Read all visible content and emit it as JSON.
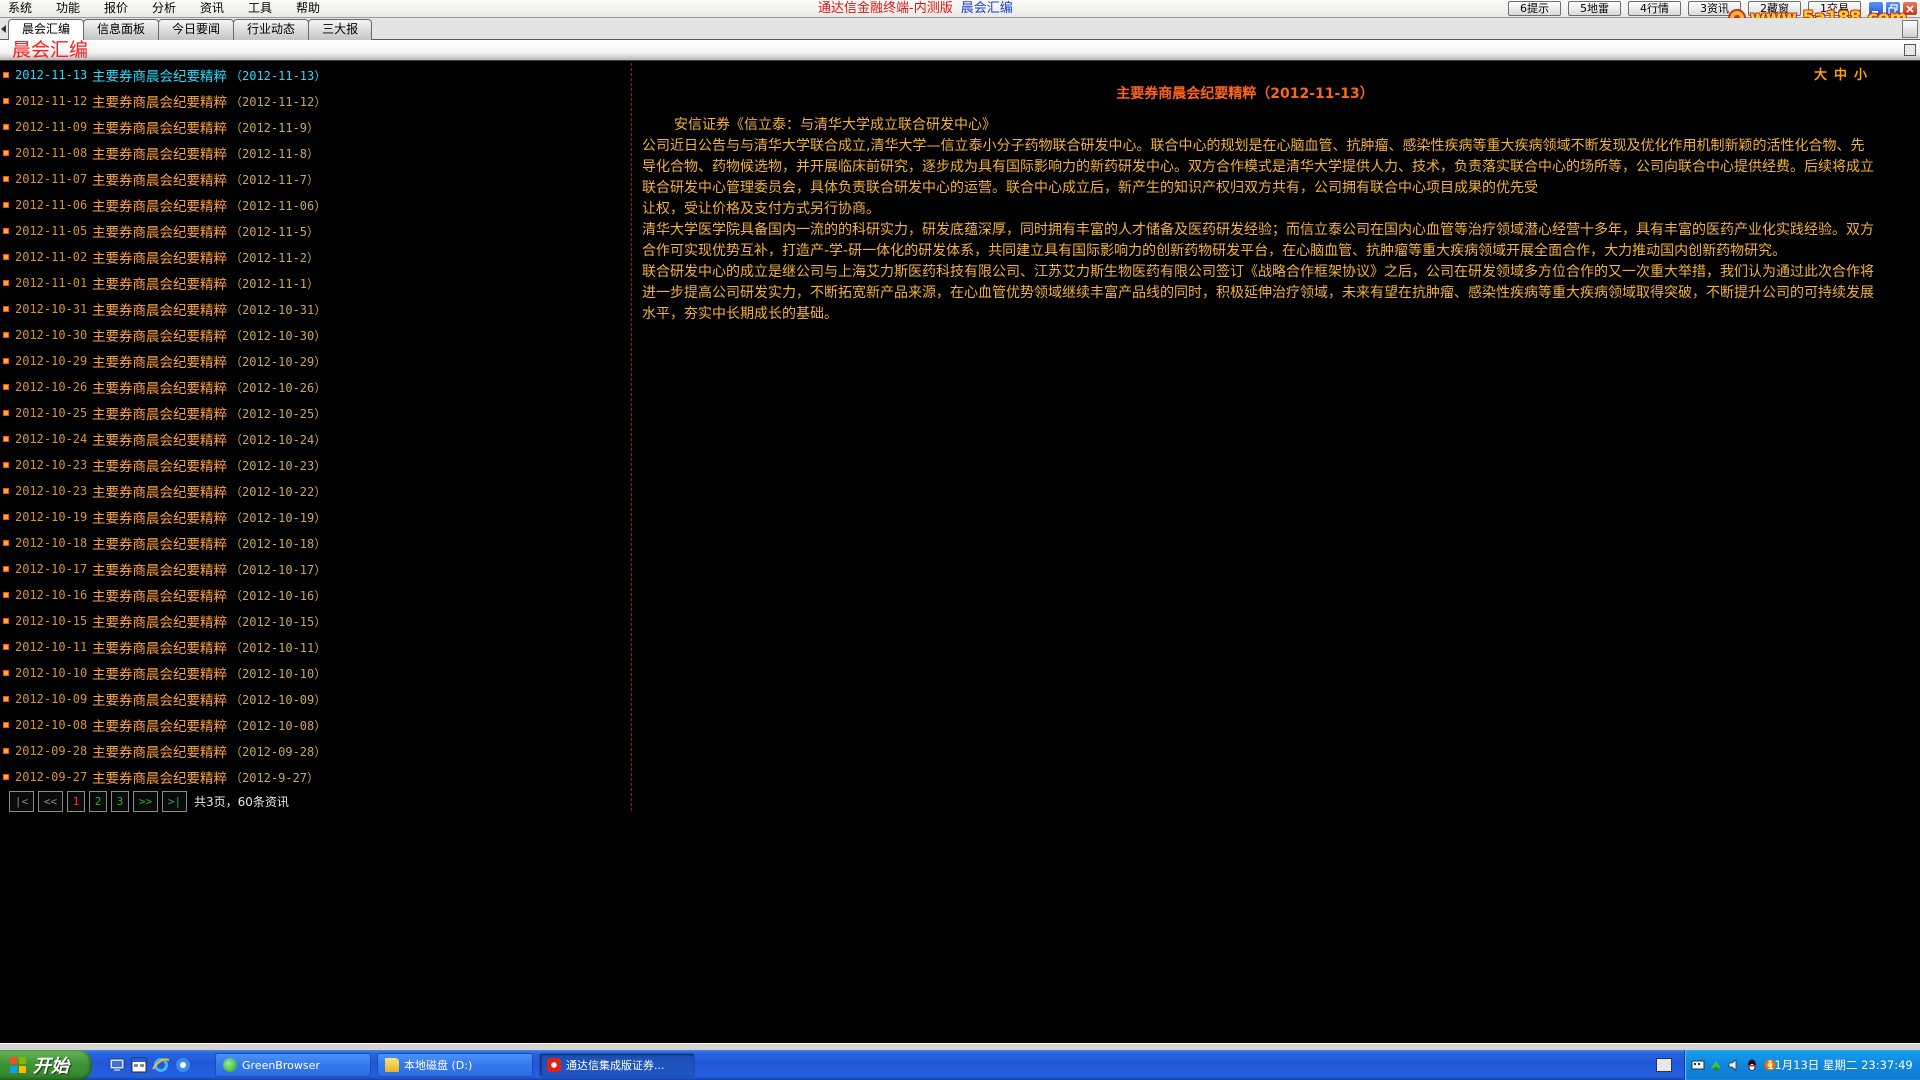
{
  "window": {
    "menu": [
      "系统",
      "功能",
      "报价",
      "分析",
      "资讯",
      "工具",
      "帮助"
    ],
    "title_app": "通达信金融终端-内测版",
    "title_page": "晨会汇编",
    "quick_buttons": [
      "6提示",
      "5地雷",
      "4行情",
      "3资讯",
      "2藏窗",
      "1交易"
    ],
    "window_controls": [
      "minimize-icon",
      "restore-icon",
      "close-icon"
    ],
    "watermark": "www.5a188.com"
  },
  "tabs": [
    {
      "label": "晨会汇编",
      "active": true
    },
    {
      "label": "信息面板"
    },
    {
      "label": "今日要闻"
    },
    {
      "label": "行业动态"
    },
    {
      "label": "三大报"
    }
  ],
  "header": {
    "title": "晨会汇编"
  },
  "list": {
    "items": [
      {
        "date": "2012-11-13",
        "title": "主要券商晨会纪要精粹",
        "suffix": "（2012-11-13）",
        "selected": true
      },
      {
        "date": "2012-11-12",
        "title": "主要券商晨会纪要精粹",
        "suffix": "（2012-11-12）"
      },
      {
        "date": "2012-11-09",
        "title": "主要券商晨会纪要精粹",
        "suffix": "（2012-11-9）"
      },
      {
        "date": "2012-11-08",
        "title": "主要券商晨会纪要精粹",
        "suffix": "（2012-11-8）"
      },
      {
        "date": "2012-11-07",
        "title": "主要券商晨会纪要精粹",
        "suffix": "（2012-11-7）"
      },
      {
        "date": "2012-11-06",
        "title": "主要券商晨会纪要精粹",
        "suffix": "（2012-11-06）"
      },
      {
        "date": "2012-11-05",
        "title": "主要券商晨会纪要精粹",
        "suffix": "（2012-11-5）"
      },
      {
        "date": "2012-11-02",
        "title": "主要券商晨会纪要精粹",
        "suffix": "（2012-11-2）"
      },
      {
        "date": "2012-11-01",
        "title": "主要券商晨会纪要精粹",
        "suffix": "（2012-11-1）"
      },
      {
        "date": "2012-10-31",
        "title": "主要券商晨会纪要精粹",
        "suffix": "（2012-10-31）"
      },
      {
        "date": "2012-10-30",
        "title": "主要券商晨会纪要精粹",
        "suffix": "（2012-10-30）"
      },
      {
        "date": "2012-10-29",
        "title": "主要券商晨会纪要精粹",
        "suffix": "（2012-10-29）"
      },
      {
        "date": "2012-10-26",
        "title": "主要券商晨会纪要精粹",
        "suffix": "（2012-10-26）"
      },
      {
        "date": "2012-10-25",
        "title": "主要券商晨会纪要精粹",
        "suffix": "（2012-10-25）"
      },
      {
        "date": "2012-10-24",
        "title": "主要券商晨会纪要精粹",
        "suffix": "（2012-10-24）"
      },
      {
        "date": "2012-10-23",
        "title": "主要券商晨会纪要精粹",
        "suffix": "（2012-10-23）"
      },
      {
        "date": "2012-10-23",
        "title": "主要券商晨会纪要精粹",
        "suffix": "（2012-10-22）"
      },
      {
        "date": "2012-10-19",
        "title": "主要券商晨会纪要精粹",
        "suffix": "（2012-10-19）"
      },
      {
        "date": "2012-10-18",
        "title": "主要券商晨会纪要精粹",
        "suffix": "（2012-10-18）"
      },
      {
        "date": "2012-10-17",
        "title": "主要券商晨会纪要精粹",
        "suffix": "（2012-10-17）"
      },
      {
        "date": "2012-10-16",
        "title": "主要券商晨会纪要精粹",
        "suffix": "（2012-10-16）"
      },
      {
        "date": "2012-10-15",
        "title": "主要券商晨会纪要精粹",
        "suffix": "（2012-10-15）"
      },
      {
        "date": "2012-10-11",
        "title": "主要券商晨会纪要精粹",
        "suffix": "（2012-10-11）"
      },
      {
        "date": "2012-10-10",
        "title": "主要券商晨会纪要精粹",
        "suffix": "（2012-10-10）"
      },
      {
        "date": "2012-10-09",
        "title": "主要券商晨会纪要精粹",
        "suffix": "（2012-10-09）"
      },
      {
        "date": "2012-10-08",
        "title": "主要券商晨会纪要精粹",
        "suffix": "（2012-10-08）"
      },
      {
        "date": "2012-09-28",
        "title": "主要券商晨会纪要精粹",
        "suffix": "（2012-09-28）"
      },
      {
        "date": "2012-09-27",
        "title": "主要券商晨会纪要精粹",
        "suffix": "（2012-9-27）"
      }
    ]
  },
  "pager": {
    "first": "|<",
    "prev": "<<",
    "pages": [
      {
        "label": "1",
        "current": true
      },
      {
        "label": "2"
      },
      {
        "label": "3"
      }
    ],
    "next": ">>",
    "last": ">|",
    "summary": "共3页，60条资讯"
  },
  "article": {
    "size_options": [
      "大",
      "中",
      "小"
    ],
    "title": "主要券商晨会纪要精粹（2012-11-13）",
    "lead": "安信证券《信立泰：与清华大学成立联合研发中心》",
    "paragraphs": [
      "公司近日公告与与清华大学联合成立,清华大学—信立泰小分子药物联合研发中心。联合中心的规划是在心脑血管、抗肿瘤、感染性疾病等重大疾病领域不断发现及优化作用机制新颖的活性化合物、先导化合物、药物候选物，并开展临床前研究，逐步成为具有国际影响力的新药研发中心。双方合作模式是清华大学提供人力、技术，负责落实联合中心的场所等，公司向联合中心提供经费。后续将成立联合研发中心管理委员会，具体负责联合研发中心的运营。联合中心成立后，新产生的知识产权归双方共有，公司拥有联合中心项目成果的优先受",
      "让权，受让价格及支付方式另行协商。",
      "清华大学医学院具备国内一流的的科研实力，研发底蕴深厚，同时拥有丰富的人才储备及医药研发经验；而信立泰公司在国内心血管等治疗领域潜心经营十多年，具有丰富的医药产业化实践经验。双方合作可实现优势互补，打造产-学-研一体化的研发体系，共同建立具有国际影响力的创新药物研发平台，在心脑血管、抗肿瘤等重大疾病领域开展全面合作，大力推动国内创新药物研究。",
      "联合研发中心的成立是继公司与上海艾力斯医药科技有限公司、江苏艾力斯生物医药有限公司签订《战略合作框架协议》之后，公司在研发领域多方位合作的又一次重大举措，我们认为通过此次合作将进一步提高公司研发实力，不断拓宽新产品来源，在心血管优势领域继续丰富产品线的同时，积极延伸治疗领域，未来有望在抗肿瘤、感染性疾病等重大疾病领域取得突破，不断提升公司的可持续发展水平，夯实中长期成长的基础。"
    ]
  },
  "taskbar": {
    "start_label": "开始",
    "quick_launch_icons": [
      "show-desktop-icon",
      "window-switch-icon",
      "ie-icon",
      "browser-icon"
    ],
    "tasks": [
      {
        "label": "GreenBrowser",
        "icon": "greenbrowser-icon"
      },
      {
        "label": "本地磁盘 (D:)",
        "icon": "folder-icon"
      },
      {
        "label": "通达信集成版证券...",
        "icon": "tdx-app-icon",
        "active": true
      }
    ],
    "tray_icons": [
      "language-bar-icon",
      "network-icon",
      "speaker-icon",
      "qq-icon",
      "security-icon"
    ],
    "clock": "11月13日 星期二 23:37:49"
  },
  "colors": {
    "app_title_red": "#e01414",
    "page_title_blue": "#1c3fd6",
    "header_red": "#ff1c1c",
    "list_date": "#d8923a",
    "list_title": "#ffa23c",
    "list_suffix": "#c9a66a",
    "list_selected": "#22ddff",
    "article_text": "#f2b23c",
    "article_title": "#ff6418",
    "font_size_control": "#ffa200",
    "divider_red": "#b01010",
    "pager_current": "#ff3030",
    "pager_link": "#22b044"
  }
}
